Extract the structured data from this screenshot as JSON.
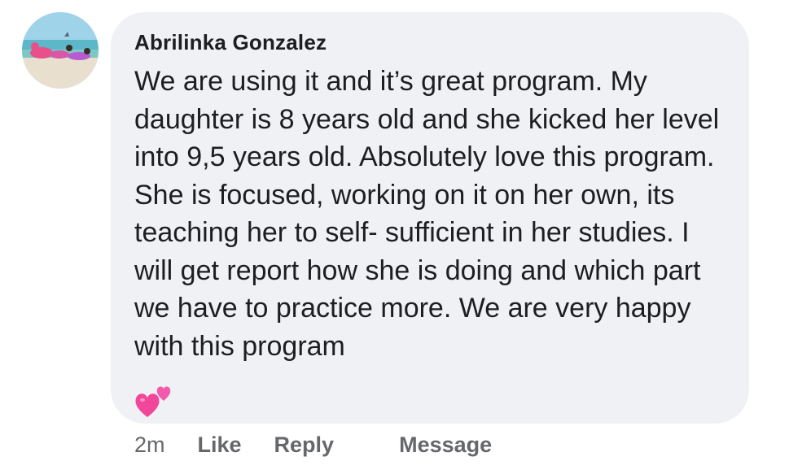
{
  "comment": {
    "author": "Abrilinka Gonzalez",
    "text": "We are using it and it’s great program. My daughter is 8 years old and she kicked her level into 9,5 years old. Absolutely love this program. She is focused, working on it on her own, its teaching her to self- sufficient in her studies. I will get report how she is doing and which part we have to practice more. We are very happy with this program",
    "emoji": "two-hearts-icon",
    "time": "2m",
    "actions": {
      "like": "Like",
      "reply": "Reply",
      "message": "Message"
    }
  },
  "colors": {
    "bubble": "#eff1f5",
    "text": "#1c1e21",
    "meta": "#65676b",
    "heart": "#f0479a"
  }
}
